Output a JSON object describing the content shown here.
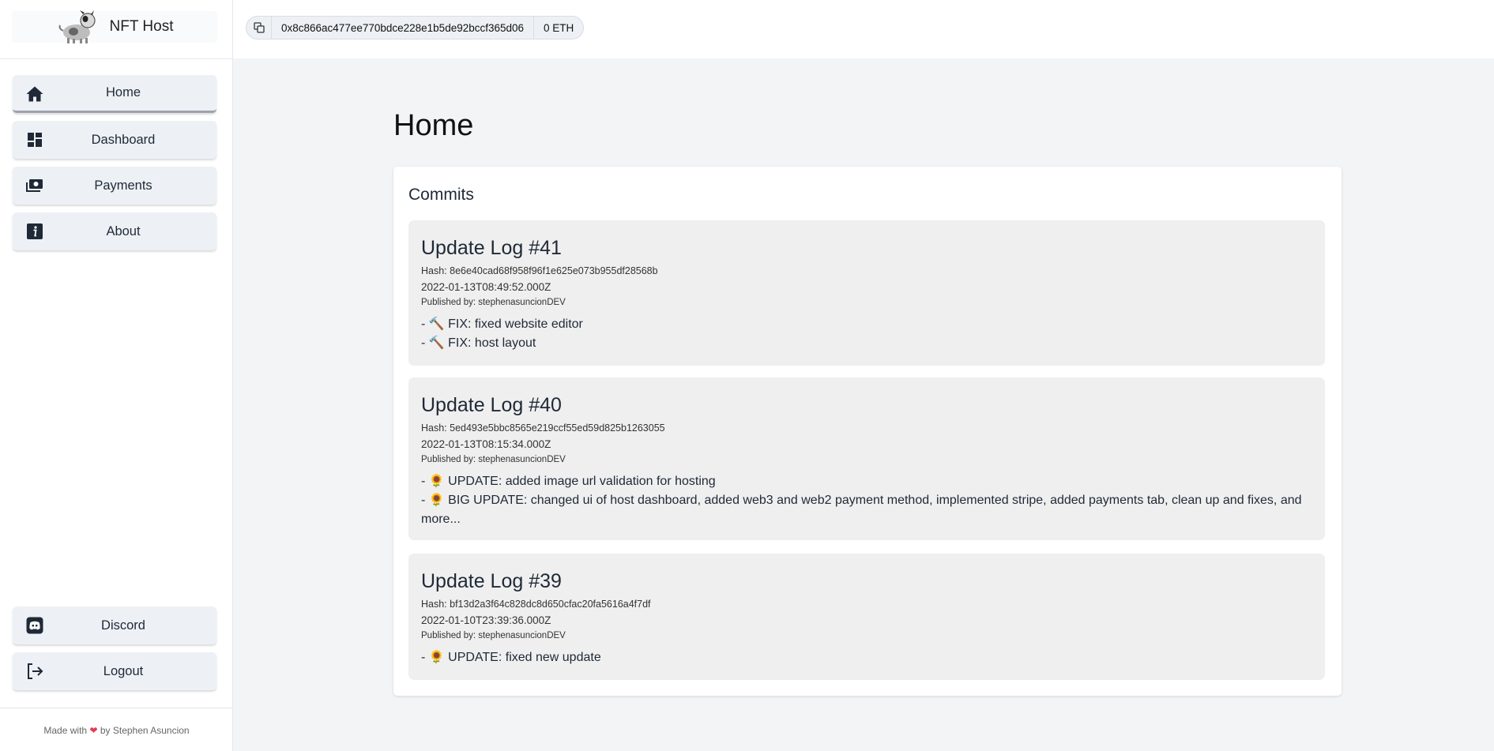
{
  "brand": {
    "name": "NFT Host"
  },
  "sidebar": {
    "nav": [
      {
        "label": "Home",
        "icon": "home-icon"
      },
      {
        "label": "Dashboard",
        "icon": "dashboard-icon"
      },
      {
        "label": "Payments",
        "icon": "payments-icon"
      },
      {
        "label": "About",
        "icon": "info-icon"
      }
    ],
    "bottom": [
      {
        "label": "Discord",
        "icon": "discord-icon"
      },
      {
        "label": "Logout",
        "icon": "logout-icon"
      }
    ],
    "footer": {
      "prefix": "Made with",
      "suffix": "by Stephen Asuncion"
    }
  },
  "wallet": {
    "address": "0x8c866ac477ee770bdce228e1b5de92bccf365d06",
    "balance": "0 ETH"
  },
  "main": {
    "title": "Home",
    "commits_title": "Commits",
    "commits": [
      {
        "title": "Update Log #41",
        "hash": "Hash: 8e6e40cad68f958f96f1e625e073b955df28568b",
        "date": "2022-01-13T08:49:52.000Z",
        "author": "Published by: stephenasuncionDEV",
        "changes": [
          "- 🔨 FIX: fixed website editor",
          "- 🔨 FIX: host layout"
        ]
      },
      {
        "title": "Update Log #40",
        "hash": "Hash: 5ed493e5bbc8565e219ccf55ed59d825b1263055",
        "date": "2022-01-13T08:15:34.000Z",
        "author": "Published by: stephenasuncionDEV",
        "changes": [
          "- 🌻 UPDATE: added image url validation for hosting",
          "- 🌻 BIG UPDATE: changed ui of host dashboard, added web3 and web2 payment method, implemented stripe, added payments tab, clean up and fixes, and more..."
        ]
      },
      {
        "title": "Update Log #39",
        "hash": "Hash: bf13d2a3f64c828dc8d650cfac20fa5616a4f7df",
        "date": "2022-01-10T23:39:36.000Z",
        "author": "Published by: stephenasuncionDEV",
        "changes": [
          "- 🌻 UPDATE: fixed new update"
        ]
      }
    ]
  }
}
